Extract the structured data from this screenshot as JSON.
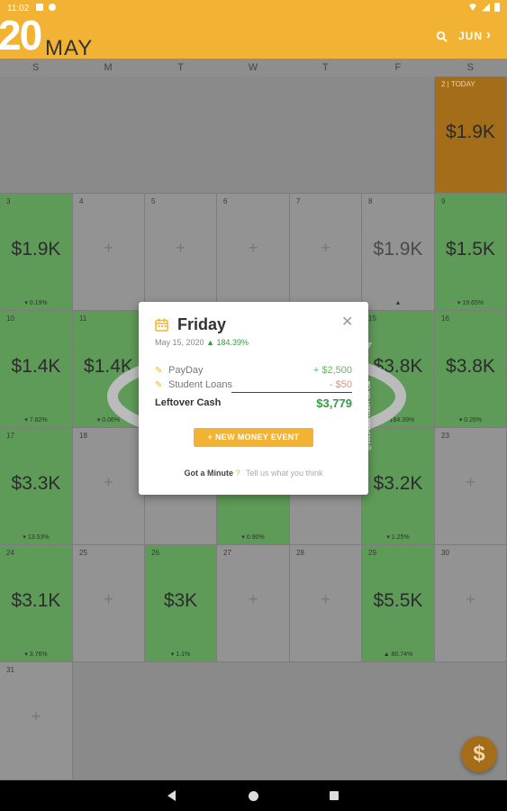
{
  "status_bar": {
    "time": "11:02"
  },
  "header": {
    "year": "20",
    "month": "MAY",
    "next_month": "JUN"
  },
  "weekdays": [
    "S",
    "M",
    "T",
    "W",
    "T",
    "F",
    "S"
  ],
  "cells": {
    "c2": {
      "day": "2 | TODAY",
      "amount": "$1.9K"
    },
    "c3": {
      "day": "3",
      "amount": "$1.9K",
      "pct": "▾ 0.19%"
    },
    "c4": {
      "day": "4"
    },
    "c5": {
      "day": "5"
    },
    "c6": {
      "day": "6"
    },
    "c7": {
      "day": "7"
    },
    "c8": {
      "day": "8",
      "amount": "$1.9K",
      "pct": "▲"
    },
    "c9": {
      "day": "9",
      "amount": "$1.5K",
      "pct": "▾ 19.65%"
    },
    "c10": {
      "day": "10",
      "amount": "$1.4K",
      "pct": "▾ 7.82%"
    },
    "c11": {
      "day": "11",
      "amount": "$1.4K",
      "pct": "▾ 0.06%"
    },
    "c15": {
      "day": "15",
      "amount": "$3.8K",
      "pct": "▲ 184.39%"
    },
    "c16": {
      "day": "16",
      "amount": "$3.8K",
      "pct": "▾ 0.26%"
    },
    "c17": {
      "day": "17",
      "amount": "$3.3K",
      "pct": "▾ 13.53%"
    },
    "c18": {
      "day": "18"
    },
    "c20": {
      "pct": "▾ 0.90%"
    },
    "c22": {
      "amount": "$3.2K",
      "pct": "▾ 1.25%"
    },
    "c23": {
      "day": "23"
    },
    "c24": {
      "day": "24",
      "amount": "$3.1K",
      "pct": "▾ 3.76%"
    },
    "c25": {
      "day": "25"
    },
    "c26": {
      "day": "26",
      "amount": "$3K",
      "pct": "▾ 1.1%"
    },
    "c27": {
      "day": "27"
    },
    "c28": {
      "day": "28"
    },
    "c29": {
      "day": "29",
      "amount": "$5.5K",
      "pct": "▲ 80.74%"
    },
    "c30": {
      "day": "30"
    },
    "c31": {
      "day": "31"
    }
  },
  "dialog": {
    "title": "Friday",
    "date": "May 15, 2020",
    "change": "▲ 184.39%",
    "items": [
      {
        "label": "PayDay",
        "amount": "+ $2,500"
      },
      {
        "label": "Student Loans",
        "amount": "- $50"
      }
    ],
    "leftover_label": "Leftover Cash",
    "leftover_amount": "$3,779",
    "button_label": "+ NEW MONEY EVENT",
    "footer_question": "Got a Minute",
    "footer_mark": "?",
    "footer_link": "Tell us what you think",
    "side_text": "©2013-2020 Cash-Flow Cal"
  },
  "fab": {
    "symbol": "$"
  },
  "colors": {
    "accent": "#f2b233",
    "green": "#2f9e41",
    "today": "#a36d19"
  }
}
